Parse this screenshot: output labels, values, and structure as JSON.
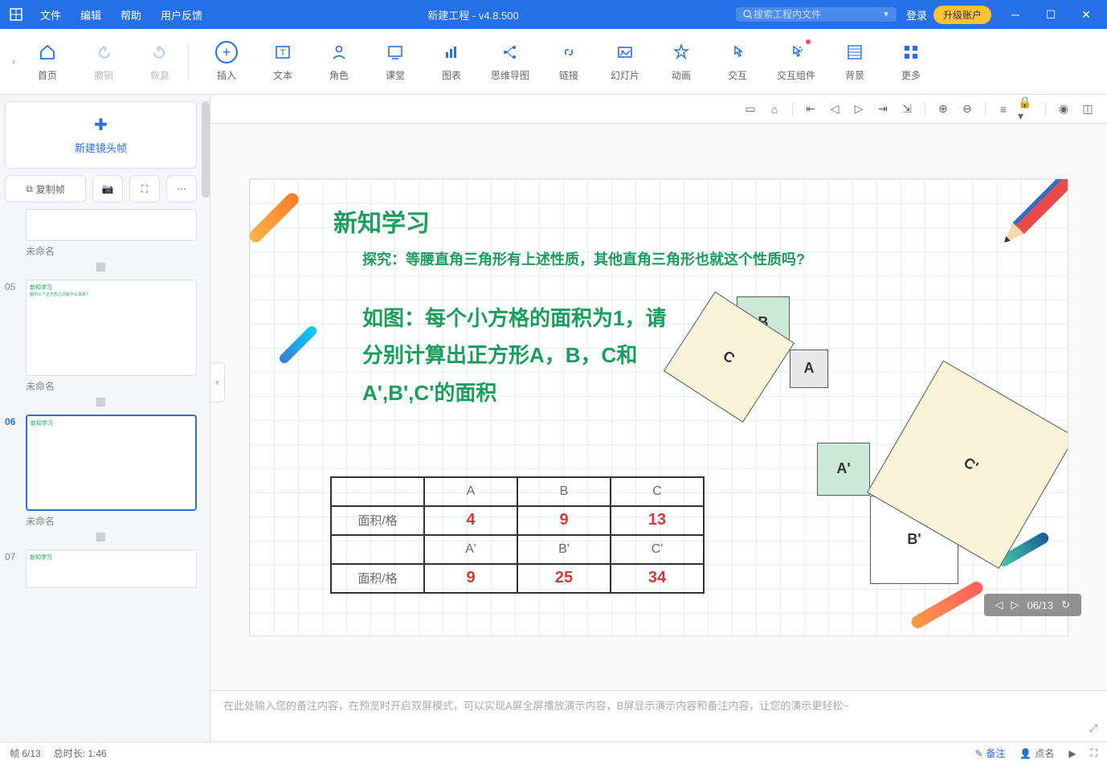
{
  "titlebar": {
    "menus": [
      "文件",
      "编辑",
      "帮助",
      "用户反馈"
    ],
    "title": "新建工程 - v4.8.500",
    "search_placeholder": "搜索工程内文件",
    "login": "登录",
    "upgrade": "升级账户"
  },
  "ribbon": {
    "home": "首页",
    "undo": "撤销",
    "redo": "恢复",
    "insert": "插入",
    "text": "文本",
    "role": "角色",
    "class": "课堂",
    "chart": "图表",
    "mindmap": "思维导图",
    "link": "链接",
    "slide": "幻灯片",
    "anim": "动画",
    "interact": "交互",
    "component": "交互组件",
    "bg": "背景",
    "more": "更多"
  },
  "sidebar": {
    "newframe": "新建镜头帧",
    "copy": "复制帧",
    "thumb_label": "未命名",
    "num05": "05",
    "num06": "06",
    "num07": "07"
  },
  "slide": {
    "title": "新知学习",
    "subtitle": "探究：等腰直角三角形有上述性质，其他直角三角形也就这个性质吗?",
    "body": "如图：每个小方格的面积为1，请分别计算出正方形A，B，C和A',B',C'的面积",
    "labels": {
      "A": "A",
      "B": "B",
      "C": "C",
      "Ap": "A'",
      "Bp": "B'",
      "Cp": "C'"
    },
    "table": {
      "row_hdr": "面积/格",
      "cols1": [
        "A",
        "B",
        "C"
      ],
      "vals1": [
        "4",
        "9",
        "13"
      ],
      "cols2": [
        "A'",
        "B'",
        "C'"
      ],
      "vals2": [
        "9",
        "25",
        "34"
      ]
    }
  },
  "notes": {
    "placeholder": "在此处输入您的备注内容，在预览时开启双屏模式，可以实现A屏全屏播放演示内容，B屏显示演示内容和备注内容，让您的演示更轻松~"
  },
  "page_badge": "06/13",
  "status": {
    "frame": "帧 6/13",
    "duration": "总时长: 1:46",
    "notes_btn": "备注",
    "roll_btn": "点名"
  }
}
